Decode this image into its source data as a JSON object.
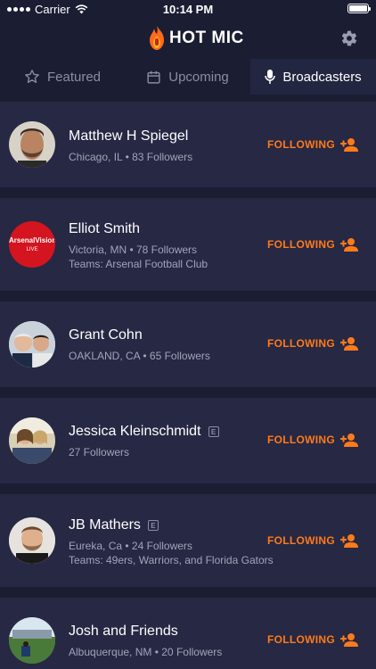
{
  "status_bar": {
    "carrier": "Carrier",
    "time": "10:14 PM"
  },
  "header": {
    "app_name": "HOT MIC"
  },
  "tabs": [
    {
      "label": "Featured",
      "icon": "star-icon",
      "active": false
    },
    {
      "label": "Upcoming",
      "icon": "calendar-icon",
      "active": false
    },
    {
      "label": "Broadcasters",
      "icon": "microphone-icon",
      "active": true
    }
  ],
  "broadcasters": [
    {
      "name": "Matthew H Spiegel",
      "line1": "Chicago, IL • 83 Followers",
      "line2": "",
      "explicit": false,
      "follow_label": "FOLLOWING"
    },
    {
      "name": "Elliot Smith",
      "line1": "Victoria, MN • 78 Followers",
      "line2": "Teams: Arsenal Football Club",
      "explicit": false,
      "follow_label": "FOLLOWING",
      "avatar_text": "ArsenalVision",
      "avatar_sub": "LIVE"
    },
    {
      "name": "Grant Cohn",
      "line1": "OAKLAND, CA • 65 Followers",
      "line2": "",
      "explicit": false,
      "follow_label": "FOLLOWING"
    },
    {
      "name": "Jessica Kleinschmidt",
      "line1": "27 Followers",
      "line2": "",
      "explicit": true,
      "explicit_label": "E",
      "follow_label": "FOLLOWING"
    },
    {
      "name": "JB Mathers",
      "line1": "Eureka, Ca • 24 Followers",
      "line2": "Teams: 49ers, Warriors, and Florida Gators",
      "explicit": true,
      "explicit_label": "E",
      "follow_label": "FOLLOWING"
    },
    {
      "name": "Josh and Friends",
      "line1": "Albuquerque, NM • 20 Followers",
      "line2": "",
      "explicit": false,
      "follow_label": "FOLLOWING"
    }
  ],
  "colors": {
    "accent": "#ff7a1a",
    "background": "#1b1d33",
    "card": "#262844"
  }
}
